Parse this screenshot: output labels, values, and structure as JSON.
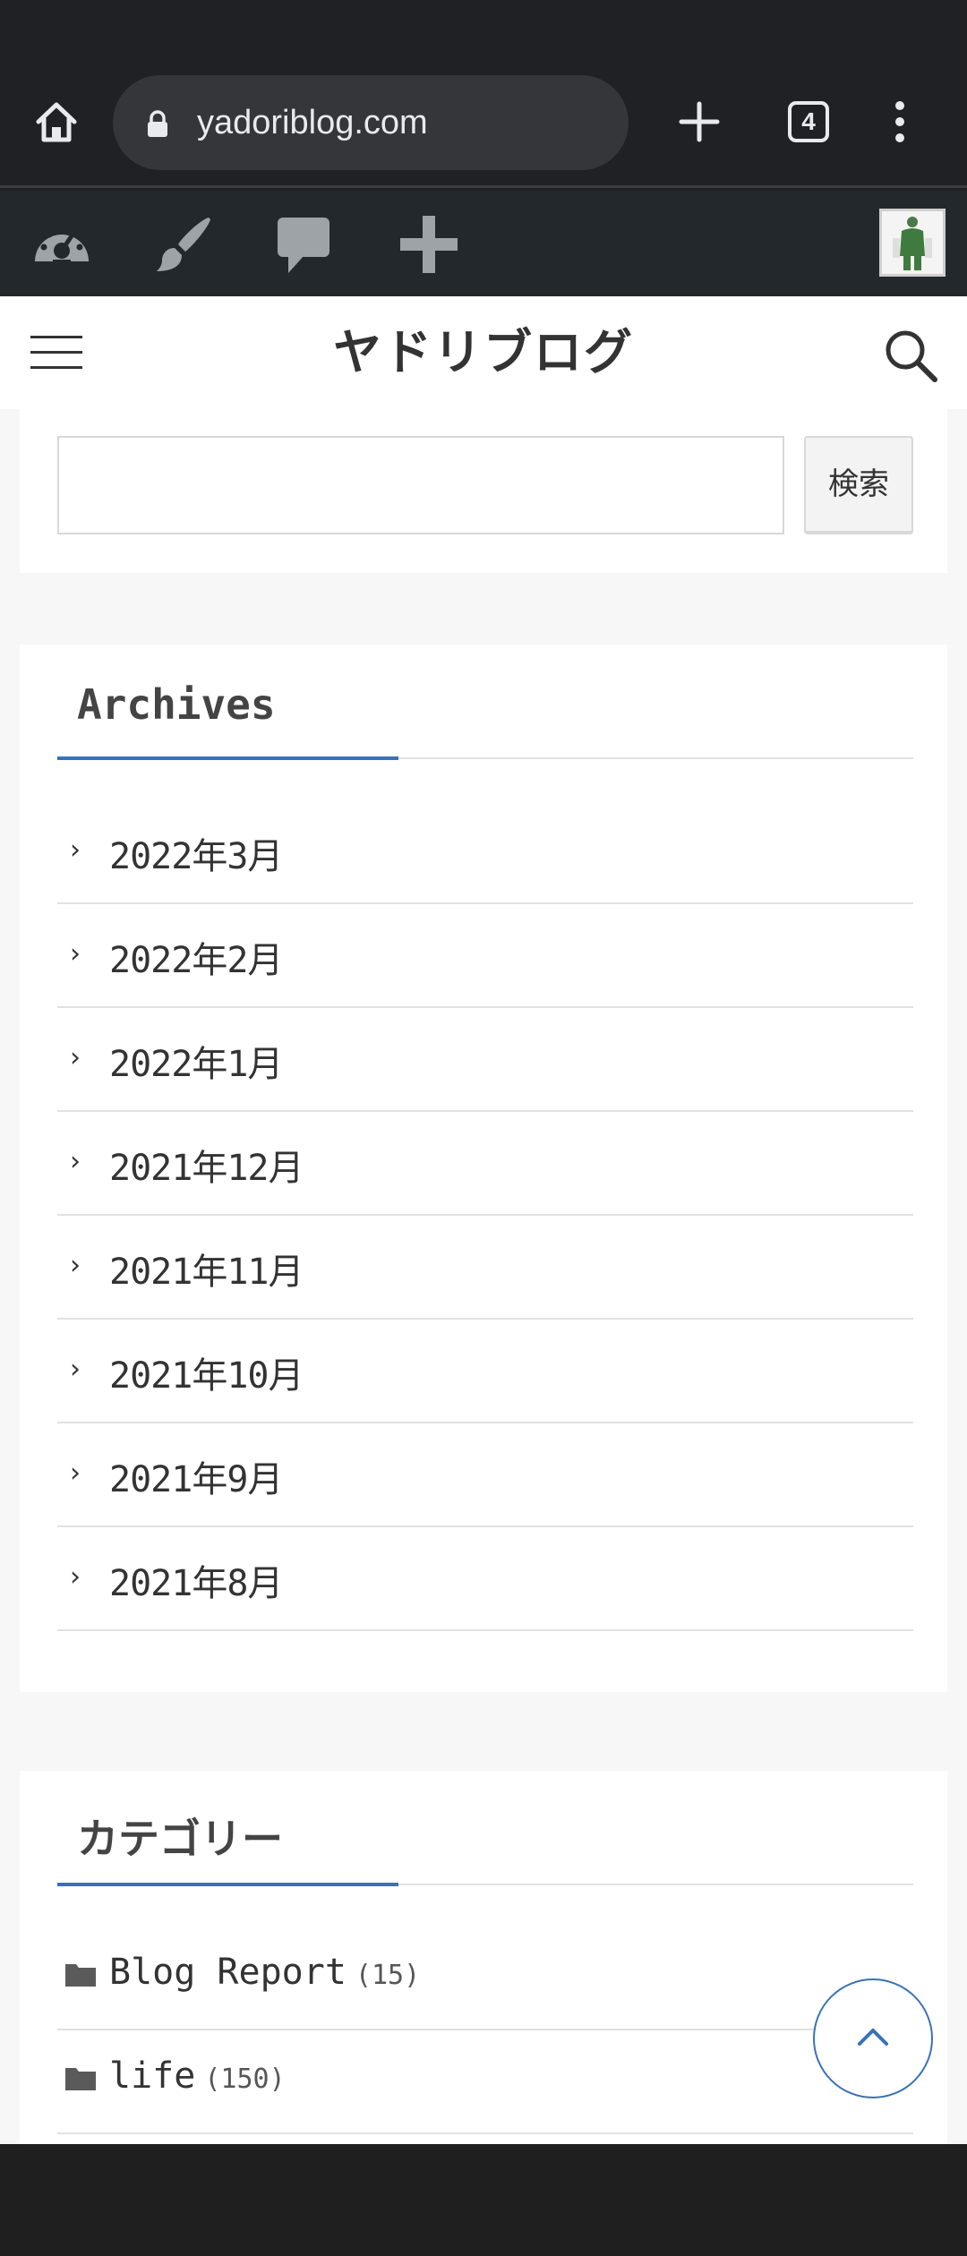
{
  "browser": {
    "url": "yadoriblog.com",
    "tab_count": "4",
    "colors": {
      "bar": "#202124",
      "url_box": "#35363a",
      "text": "#e8eaed"
    },
    "icons": [
      "home-icon",
      "lock-icon",
      "plus-icon",
      "tabs-icon",
      "more-vert-icon"
    ]
  },
  "admin_bar": {
    "icons": [
      "dashboard-icon",
      "customize-brush-icon",
      "comments-icon",
      "new-content-plus-icon",
      "user-avatar"
    ]
  },
  "header": {
    "title": "ヤドリブログ",
    "icons": [
      "hamburger-menu-icon",
      "search-icon"
    ]
  },
  "search_widget": {
    "input_value": "",
    "button_label": "検索"
  },
  "archives": {
    "title": "Archives",
    "items": [
      {
        "label": "2022年3月"
      },
      {
        "label": "2022年2月"
      },
      {
        "label": "2022年1月"
      },
      {
        "label": "2021年12月"
      },
      {
        "label": "2021年11月"
      },
      {
        "label": "2021年10月"
      },
      {
        "label": "2021年9月"
      },
      {
        "label": "2021年8月"
      }
    ]
  },
  "categories": {
    "title": "カテゴリー",
    "items": [
      {
        "label": "Blog Report",
        "count": "(15)"
      },
      {
        "label": "life",
        "count": "(150)"
      }
    ]
  },
  "accent_color": "#3a72b8"
}
